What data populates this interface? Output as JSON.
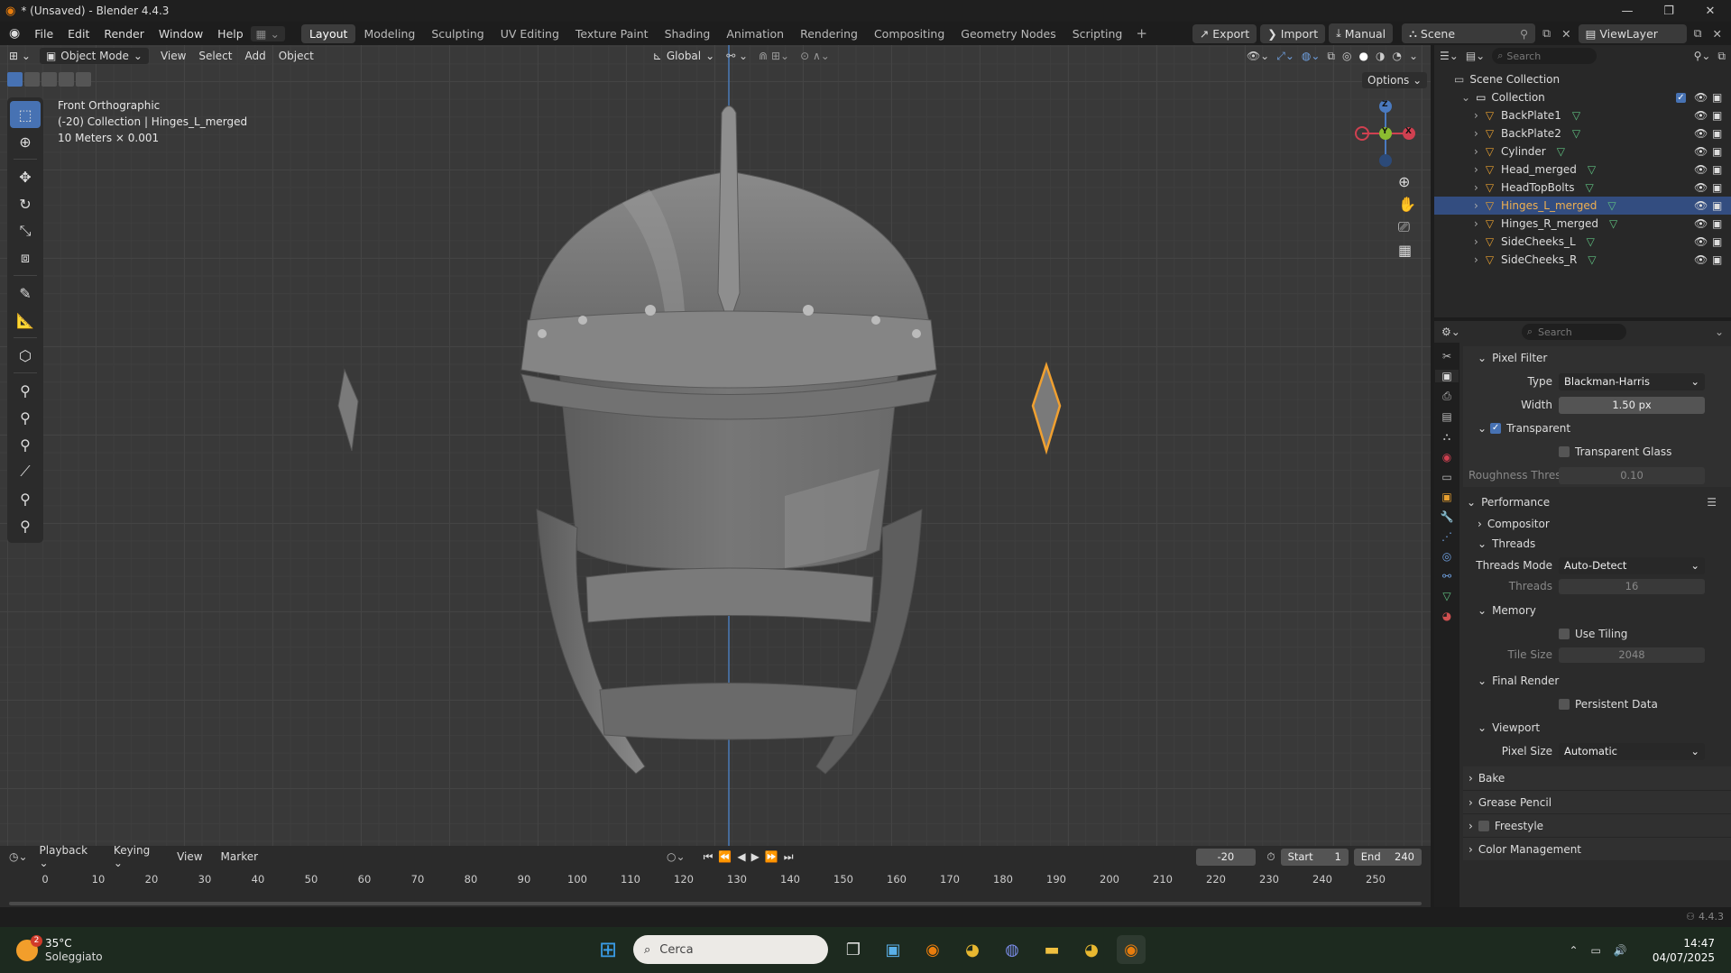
{
  "window": {
    "title": "* (Unsaved) - Blender 4.4.3"
  },
  "menus": [
    "File",
    "Edit",
    "Render",
    "Window",
    "Help"
  ],
  "workspaces": [
    "Layout",
    "Modeling",
    "Sculpting",
    "UV Editing",
    "Texture Paint",
    "Shading",
    "Animation",
    "Rendering",
    "Compositing",
    "Geometry Nodes",
    "Scripting"
  ],
  "topright": {
    "export": "Export",
    "import": "Import",
    "manual": "Manual",
    "scene": "Scene",
    "viewlayer": "ViewLayer"
  },
  "viewport_header": {
    "mode": "Object Mode",
    "view": "View",
    "select": "Select",
    "add": "Add",
    "object": "Object",
    "orientation": "Global",
    "options": "Options"
  },
  "viewport_info": {
    "line1": "Front Orthographic",
    "line2": "(-20) Collection | Hinges_L_merged",
    "line3": "10 Meters × 0.001"
  },
  "gizmo": {
    "z": "Z",
    "y": "Y",
    "x": "X"
  },
  "outliner": {
    "search_placeholder": "Search",
    "scene_collection": "Scene Collection",
    "collection": "Collection",
    "items": [
      {
        "name": "BackPlate1",
        "selected": false
      },
      {
        "name": "BackPlate2",
        "selected": false
      },
      {
        "name": "Cylinder",
        "selected": false
      },
      {
        "name": "Head_merged",
        "selected": false
      },
      {
        "name": "HeadTopBolts",
        "selected": false
      },
      {
        "name": "Hinges_L_merged",
        "selected": true
      },
      {
        "name": "Hinges_R_merged",
        "selected": false
      },
      {
        "name": "SideCheeks_L",
        "selected": false
      },
      {
        "name": "SideCheeks_R",
        "selected": false
      }
    ]
  },
  "properties": {
    "search_placeholder": "Search",
    "pixel_filter": "Pixel Filter",
    "type_label": "Type",
    "type_value": "Blackman-Harris",
    "width_label": "Width",
    "width_value": "1.50 px",
    "transparent": "Transparent",
    "transparent_glass": "Transparent Glass",
    "roughness_label": "Roughness Thres...",
    "roughness_value": "0.10",
    "performance": "Performance",
    "compositor": "Compositor",
    "threads": "Threads",
    "threads_mode_label": "Threads Mode",
    "threads_mode_value": "Auto-Detect",
    "threads_label": "Threads",
    "threads_value": "16",
    "memory": "Memory",
    "use_tiling": "Use Tiling",
    "tile_size_label": "Tile Size",
    "tile_size_value": "2048",
    "final_render": "Final Render",
    "persistent_data": "Persistent Data",
    "viewport": "Viewport",
    "pixel_size_label": "Pixel Size",
    "pixel_size_value": "Automatic",
    "bake": "Bake",
    "grease_pencil": "Grease Pencil",
    "freestyle": "Freestyle",
    "color_management": "Color Management"
  },
  "timeline": {
    "playback": "Playback",
    "keying": "Keying",
    "view": "View",
    "marker": "Marker",
    "current_frame": "-20",
    "start_label": "Start",
    "start_value": "1",
    "end_label": "End",
    "end_value": "240",
    "ticks": [
      "0",
      "10",
      "20",
      "30",
      "40",
      "50",
      "60",
      "70",
      "80",
      "90",
      "100",
      "110",
      "120",
      "130",
      "140",
      "150",
      "160",
      "170",
      "180",
      "190",
      "200",
      "210",
      "220",
      "230",
      "240",
      "250"
    ]
  },
  "statusbar": {
    "version": "4.4.3"
  },
  "taskbar": {
    "temp": "35°C",
    "weather": "Soleggiato",
    "badge": "2",
    "search": "Cerca",
    "time": "14:47",
    "date": "04/07/2025"
  },
  "colors": {
    "accent": "#4772b3",
    "selection_orange": "#f0a030",
    "viewport_bg": "#393939"
  }
}
